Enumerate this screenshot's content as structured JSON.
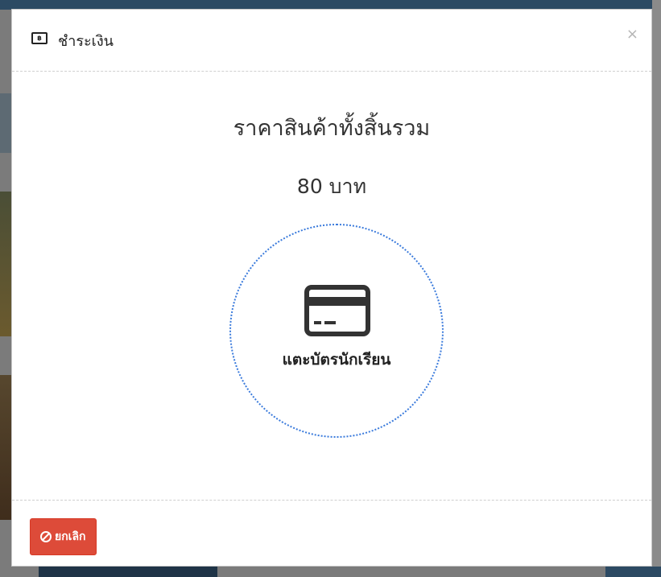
{
  "modal": {
    "title": "ชำระเงิน",
    "title_icon": "money-bill-icon",
    "title_icon_glyph": "฿",
    "close_label": "×",
    "total_label": "ราคาสินค้าทั้งสิ้นรวม",
    "total_amount": "80 บาท",
    "card_icon": "credit-card-icon",
    "card_prompt": "แตะบัตรนักเรียน",
    "cancel_label": "ยกเลิก",
    "cancel_icon": "ban-icon"
  },
  "colors": {
    "accent_blue": "#3b7bdc",
    "cancel_red": "#dd4b39",
    "overlay": "#7b7b7b"
  }
}
